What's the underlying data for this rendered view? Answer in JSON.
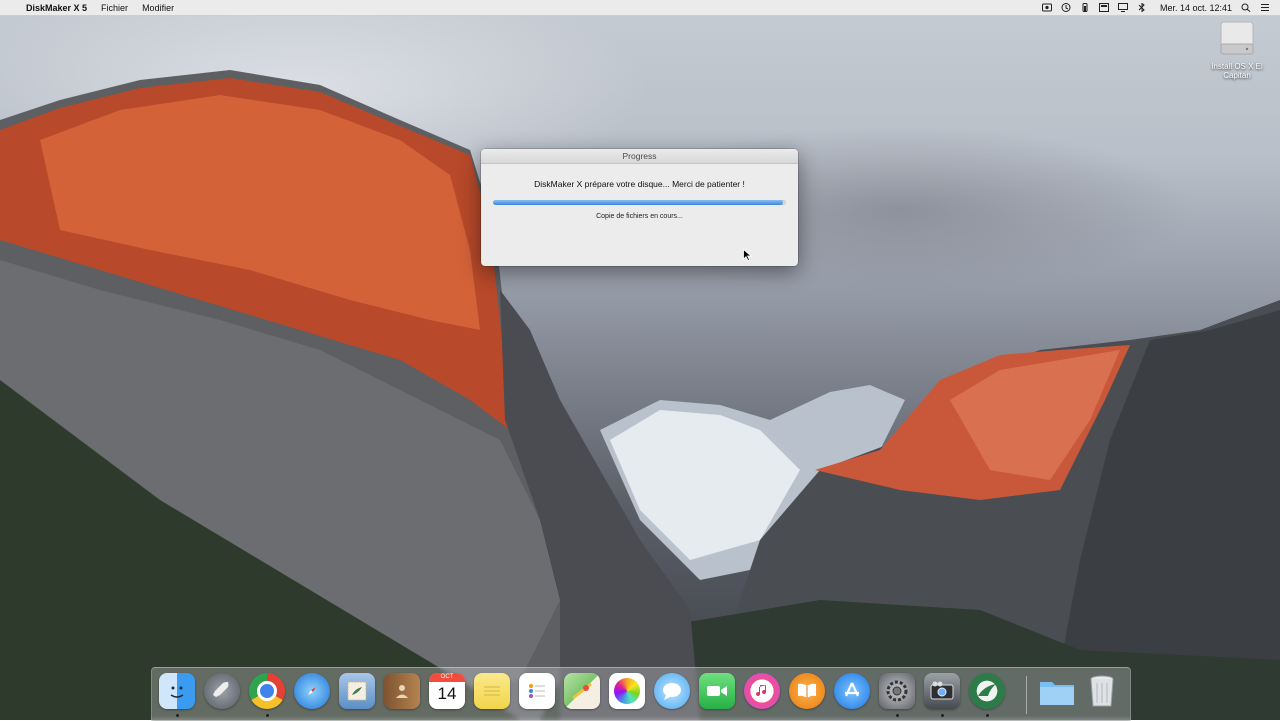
{
  "menubar": {
    "apple_glyph": "",
    "app_name": "DiskMaker X 5",
    "menus": [
      "Fichier",
      "Modifier"
    ],
    "clock": "Mer. 14 oct.  12:41",
    "status_icons": [
      "screen-record-icon",
      "time-machine-icon",
      "battery-icon",
      "notification-icon",
      "display-icon",
      "bluetooth-icon",
      "spotlight-icon",
      "notification-center-icon"
    ]
  },
  "desktop": {
    "volume_label": "Install OS X El Capitan"
  },
  "progress_window": {
    "title": "Progress",
    "message": "DiskMaker X prépare votre disque... Merci de patienter !",
    "progress_fraction": 0.99,
    "status": "Copie de fichiers en cours..."
  },
  "dock": {
    "calendar_month": "OCT",
    "calendar_day": "14",
    "items": [
      {
        "name": "finder",
        "color": "#3a9bf0"
      },
      {
        "name": "launchpad",
        "color": "#6b6f78"
      },
      {
        "name": "chrome",
        "color": "#ffffff"
      },
      {
        "name": "safari",
        "color": "#2b8fe8"
      },
      {
        "name": "mail",
        "color": "#6ba0d8"
      },
      {
        "name": "contacts",
        "color": "#b07c46"
      },
      {
        "name": "calendar",
        "color": "#ffffff"
      },
      {
        "name": "notes",
        "color": "#f7e27a"
      },
      {
        "name": "reminders",
        "color": "#ffffff"
      },
      {
        "name": "maps",
        "color": "#8ccf7e"
      },
      {
        "name": "photos",
        "color": "#ffffff"
      },
      {
        "name": "messages",
        "color": "#5ab8f5"
      },
      {
        "name": "facetime",
        "color": "#3bc95b"
      },
      {
        "name": "itunes",
        "color": "#ffffff"
      },
      {
        "name": "ibooks",
        "color": "#f39426"
      },
      {
        "name": "app-store",
        "color": "#2c8ff0"
      },
      {
        "name": "system-preferences",
        "color": "#8c8f96"
      },
      {
        "name": "photo-booth",
        "color": "#4d5358"
      },
      {
        "name": "diskmaker-x",
        "color": "#2e7b4a"
      },
      {
        "name": "downloads-folder",
        "color": "#7ec2f3"
      },
      {
        "name": "trash",
        "color": "#d6d9dc"
      }
    ]
  }
}
